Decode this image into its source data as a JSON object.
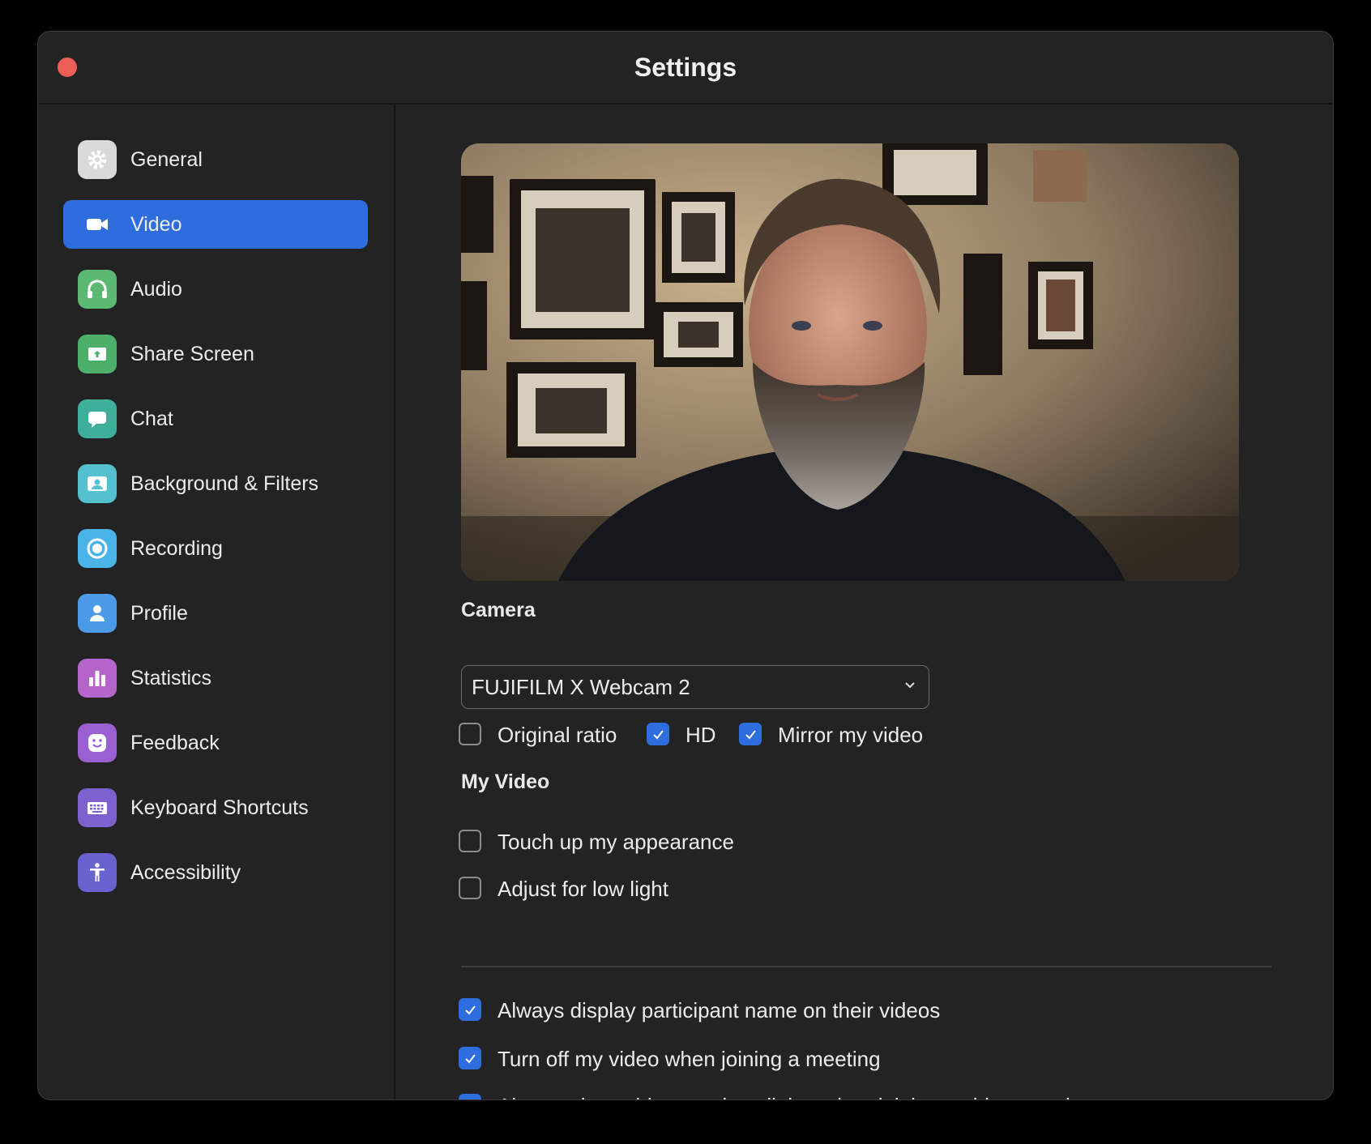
{
  "window": {
    "title": "Settings"
  },
  "sidebar": {
    "items": [
      {
        "label": "General",
        "icon": "gear-icon",
        "color": "#d9d9d9",
        "active": false
      },
      {
        "label": "Video",
        "icon": "video-camera-icon",
        "color": "#2e6ddd",
        "active": true
      },
      {
        "label": "Audio",
        "icon": "headphones-icon",
        "color": "#5bb974",
        "active": false
      },
      {
        "label": "Share Screen",
        "icon": "share-screen-icon",
        "color": "#4caf6a",
        "active": false
      },
      {
        "label": "Chat",
        "icon": "chat-bubble-icon",
        "color": "#3fae9b",
        "active": false
      },
      {
        "label": "Background & Filters",
        "icon": "person-portrait-icon",
        "color": "#55c1cf",
        "active": false
      },
      {
        "label": "Recording",
        "icon": "record-icon",
        "color": "#4ab4e6",
        "active": false
      },
      {
        "label": "Profile",
        "icon": "user-icon",
        "color": "#4c9be8",
        "active": false
      },
      {
        "label": "Statistics",
        "icon": "bar-chart-icon",
        "color": "#b565c9",
        "active": false
      },
      {
        "label": "Feedback",
        "icon": "smiley-icon",
        "color": "#9a5fd0",
        "active": false
      },
      {
        "label": "Keyboard Shortcuts",
        "icon": "keyboard-icon",
        "color": "#7d62cf",
        "active": false
      },
      {
        "label": "Accessibility",
        "icon": "accessibility-icon",
        "color": "#6a62cf",
        "active": false
      }
    ]
  },
  "video": {
    "camera_title": "Camera",
    "camera_selected": "FUJIFILM X Webcam 2",
    "camera_options": [
      {
        "label": "Original ratio",
        "checked": false
      },
      {
        "label": "HD",
        "checked": true
      },
      {
        "label": "Mirror my video",
        "checked": true
      }
    ],
    "my_video_title": "My Video",
    "my_video_options": [
      {
        "label": "Touch up my appearance",
        "checked": false
      },
      {
        "label": "Adjust for low light",
        "checked": false
      }
    ],
    "more_options": [
      {
        "label": "Always display participant name on their videos",
        "checked": true
      },
      {
        "label": "Turn off my video when joining a meeting",
        "checked": true
      },
      {
        "label": "Always show video preview dialog when joining a video meeting",
        "checked": true
      }
    ]
  },
  "colors": {
    "accent": "#2e6ddd",
    "close": "#ec5f57",
    "window_bg": "#232323"
  }
}
